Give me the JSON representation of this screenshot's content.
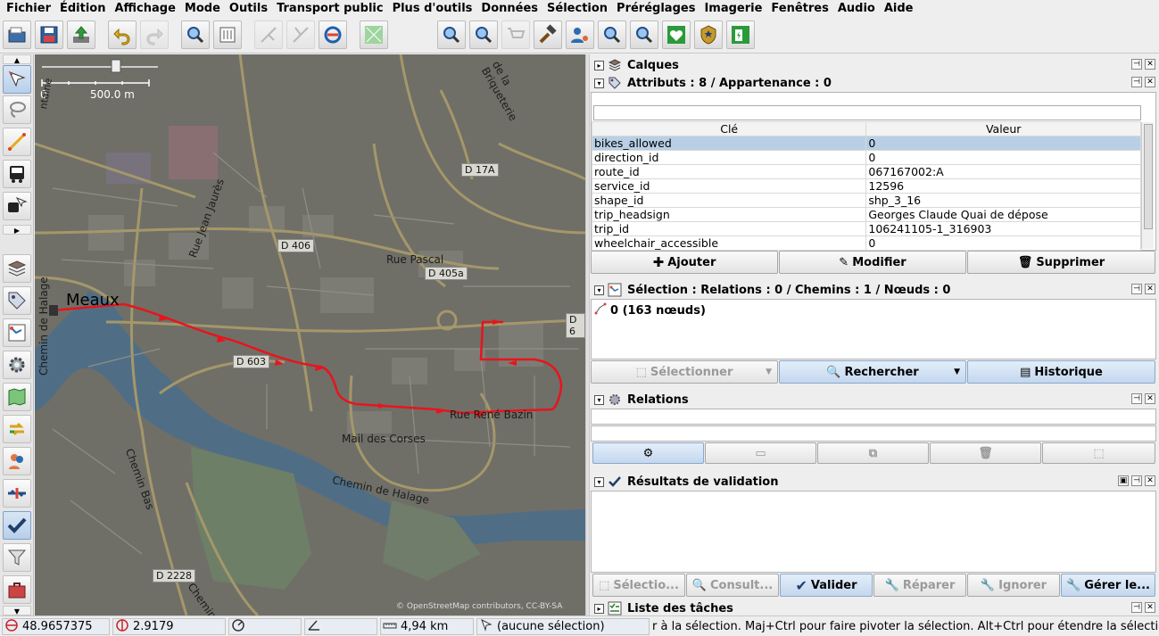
{
  "menu": {
    "items": [
      "Fichier",
      "Édition",
      "Affichage",
      "Mode",
      "Outils",
      "Transport public",
      "Plus d'outils",
      "Données",
      "Sélection",
      "Préréglages",
      "Imagerie",
      "Fenêtres",
      "Audio",
      "Aide"
    ]
  },
  "map": {
    "scale_start": "0",
    "scale_value": "500.0 m",
    "city_label": "Meaux",
    "road_labels": {
      "d17a": "D 17A",
      "d406": "D 406",
      "d405a": "D 405a",
      "d603": "D 603",
      "d6": "D 6",
      "d2228": "D 2228"
    },
    "street_labels": {
      "rue_pascal": "Rue Pascal",
      "rue_jean_jaures": "Rue Jean Jaurès",
      "rue_briqueterie": "de la Briqueterie",
      "mail_corses": "Mail des Corses",
      "chemin_halage": "Chemin de Halage",
      "chemin_halage_v": "Chemin de Halage",
      "chemin_bas": "Chemin Bas",
      "chemin_bas2": "Chemin Bas",
      "rue_rene_bazin": "Rue René Bazin",
      "ne_top": "ntaine"
    },
    "attribution": "© OpenStreetMap contributors, CC-BY-SA",
    "colors": {
      "route": "#e8141c",
      "background": "#6d6d66",
      "roads": "#a89b6a"
    }
  },
  "panels": {
    "layers": {
      "title": "Calques"
    },
    "attributes": {
      "title": "Attributs : 8 / Appartenance : 0",
      "search_value": "",
      "col_key": "Clé",
      "col_value": "Valeur",
      "rows": [
        {
          "key": "bikes_allowed",
          "value": "0"
        },
        {
          "key": "direction_id",
          "value": "0"
        },
        {
          "key": "route_id",
          "value": "067167002:A"
        },
        {
          "key": "service_id",
          "value": "12596"
        },
        {
          "key": "shape_id",
          "value": "shp_3_16"
        },
        {
          "key": "trip_headsign",
          "value": "Georges Claude Quai de dépose"
        },
        {
          "key": "trip_id",
          "value": "106241105-1_316903"
        },
        {
          "key": "wheelchair_accessible",
          "value": "0"
        }
      ],
      "buttons": {
        "add": "Ajouter",
        "edit": "Modifier",
        "delete": "Supprimer"
      }
    },
    "selection": {
      "title": "Sélection : Relations : 0 / Chemins : 1 / Nœuds : 0",
      "item": "0 (163 nœuds)",
      "buttons": {
        "select": "Sélectionner",
        "search": "Rechercher",
        "history": "Historique"
      }
    },
    "relations": {
      "title": "Relations"
    },
    "validation": {
      "title": "Résultats de validation",
      "buttons": {
        "select": "Sélectio...",
        "lookup": "Consult...",
        "validate": "Valider",
        "fix": "Réparer",
        "ignore": "Ignorer",
        "manage": "Gérer le..."
      }
    },
    "tasks": {
      "title": "Liste des tâches"
    }
  },
  "status": {
    "lat": "48.9657375",
    "lon": "2.9179",
    "distance": "4,94 km",
    "selection": "(aucune sélection)",
    "help": "r à la sélection. Maj+Ctrl pour faire pivoter la sélection. Alt+Ctrl pour étendre la sélection."
  }
}
